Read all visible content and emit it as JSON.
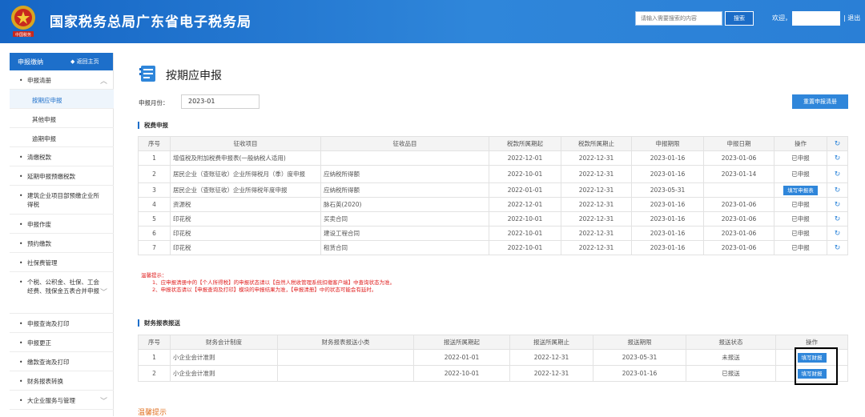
{
  "header": {
    "site_title": "国家税务总局广东省电子税务局",
    "emblem_text": "中国税务",
    "search_placeholder": "请输入需要搜索的内容",
    "search_button": "搜索",
    "welcome": "欢迎，",
    "logout": "| 退出"
  },
  "sidebar": {
    "title": "申报缴纳",
    "back_home": "返回主页",
    "items": [
      {
        "label": "申报清册",
        "expanded": true
      },
      {
        "label": "按期应申报"
      },
      {
        "label": "其他申报"
      },
      {
        "label": "逾期申报"
      },
      {
        "label": "清缴税款"
      },
      {
        "label": "延期申报预缴税款"
      },
      {
        "label": "建筑企业项目部预缴企业所得税"
      },
      {
        "label": "申报作废"
      },
      {
        "label": "预约缴款"
      },
      {
        "label": "社保费管理"
      },
      {
        "label": "个税、公积金、社保、工会经费、残保金五表合并申报"
      },
      {
        "label": "申报查询及打印"
      },
      {
        "label": "申报更正"
      },
      {
        "label": "缴款查询及打印"
      },
      {
        "label": "财务报表转换"
      },
      {
        "label": "大企业服务与管理"
      }
    ]
  },
  "main": {
    "page_title": "按期应申报",
    "month_label": "申报月份：",
    "month_value": "2023-01",
    "reset_button": "重置申报清册",
    "tax_section_title": "税费申报",
    "tax_table": {
      "headers": [
        "序号",
        "征收项目",
        "征收品目",
        "税款所属期起",
        "税款所属期止",
        "申报期限",
        "申报日期",
        "操作"
      ],
      "rows": [
        {
          "no": "1",
          "item": "增值税及附加税费申报表(一般纳税人适用)",
          "sub": "",
          "start": "2022-12-01",
          "end": "2022-12-31",
          "deadline": "2023-01-16",
          "date": "2023-01-06",
          "op": "已申报"
        },
        {
          "no": "2",
          "item": "居民企业（查账征收）企业所得税月（季）度申报",
          "sub": "应纳税所得额",
          "start": "2022-10-01",
          "end": "2022-12-31",
          "deadline": "2023-01-16",
          "date": "2023-01-14",
          "op": "已申报"
        },
        {
          "no": "3",
          "item": "居民企业（查账征收）企业所得税年度申报",
          "sub": "应纳税所得额",
          "start": "2022-01-01",
          "end": "2022-12-31",
          "deadline": "2023-05-31",
          "date": "",
          "op": "填写申报表"
        },
        {
          "no": "4",
          "item": "资源税",
          "sub": "脉石英(2020)",
          "start": "2022-12-01",
          "end": "2022-12-31",
          "deadline": "2023-01-16",
          "date": "2023-01-06",
          "op": "已申报"
        },
        {
          "no": "5",
          "item": "印花税",
          "sub": "买卖合同",
          "start": "2022-10-01",
          "end": "2022-12-31",
          "deadline": "2023-01-16",
          "date": "2023-01-06",
          "op": "已申报"
        },
        {
          "no": "6",
          "item": "印花税",
          "sub": "建设工程合同",
          "start": "2022-10-01",
          "end": "2022-12-31",
          "deadline": "2023-01-16",
          "date": "2023-01-06",
          "op": "已申报"
        },
        {
          "no": "7",
          "item": "印花税",
          "sub": "租赁合同",
          "start": "2022-10-01",
          "end": "2022-12-31",
          "deadline": "2023-01-16",
          "date": "2023-01-06",
          "op": "已申报"
        }
      ]
    },
    "tips": {
      "title": "温馨提示：",
      "line1": "1、应申报清册中的【个人所得税】的申报状态请以【自然人税收管理系统扣缴客户端】中查询状态为准。",
      "line2": "2、申报状态请以【申报查询及打印】模块的申报结果为准，【申报清册】中的状态可能会有延时。"
    },
    "fin_section_title": "财务报表报送",
    "fin_table": {
      "headers": [
        "序号",
        "财务会计制度",
        "财务报表报送小类",
        "报送所属期起",
        "报送所属期止",
        "报送期限",
        "报送状态",
        "操作"
      ],
      "rows": [
        {
          "no": "1",
          "system": "小企业会计准则",
          "sub": "",
          "start": "2022-01-01",
          "end": "2022-12-31",
          "deadline": "2023-05-31",
          "status": "未报送",
          "op": "填写财报"
        },
        {
          "no": "2",
          "system": "小企业会计准则",
          "sub": "",
          "start": "2022-10-01",
          "end": "2022-12-31",
          "deadline": "2023-01-16",
          "status": "已报送",
          "op": "填写财报"
        }
      ]
    },
    "bottom_tip": "温馨提示"
  },
  "colors": {
    "header_blue": "#1d6fca",
    "accent_blue": "#2f86da",
    "tip_red": "#e02020",
    "tip_orange": "#e07020"
  }
}
